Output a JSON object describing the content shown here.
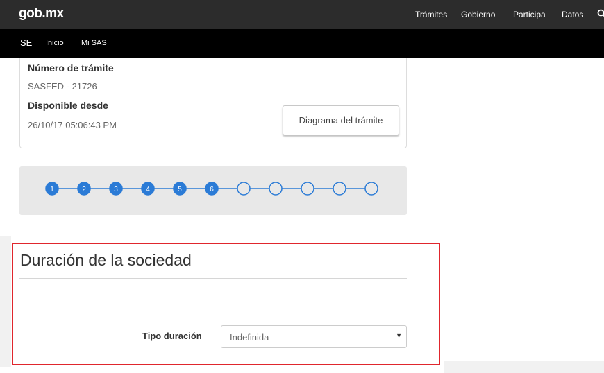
{
  "header": {
    "brand": "gob.mx",
    "nav": [
      "Trámites",
      "Gobierno",
      "Participa",
      "Datos"
    ]
  },
  "subnav": {
    "section": "SE",
    "links": [
      "Inicio",
      "Mi SAS"
    ]
  },
  "info": {
    "tramite_label": "Número de trámite",
    "tramite_value": "SASFED - 21726",
    "disponible_label": "Disponible desde",
    "disponible_value": "26/10/17 05:06:43 PM",
    "diagram_button": "Diagrama del trámite"
  },
  "stepper": {
    "total_steps": 11,
    "completed_steps": 6,
    "labels": [
      "1",
      "2",
      "3",
      "4",
      "5",
      "6"
    ],
    "active_color": "#2b7bd6",
    "inactive_color": "#2b7bd6"
  },
  "section": {
    "title": "Duración de la sociedad",
    "field_label": "Tipo duración",
    "select_value": "Indefinida"
  },
  "colors": {
    "topbar": "#2c2c2c",
    "subbar": "#000000",
    "highlight_border": "#e0262d"
  }
}
